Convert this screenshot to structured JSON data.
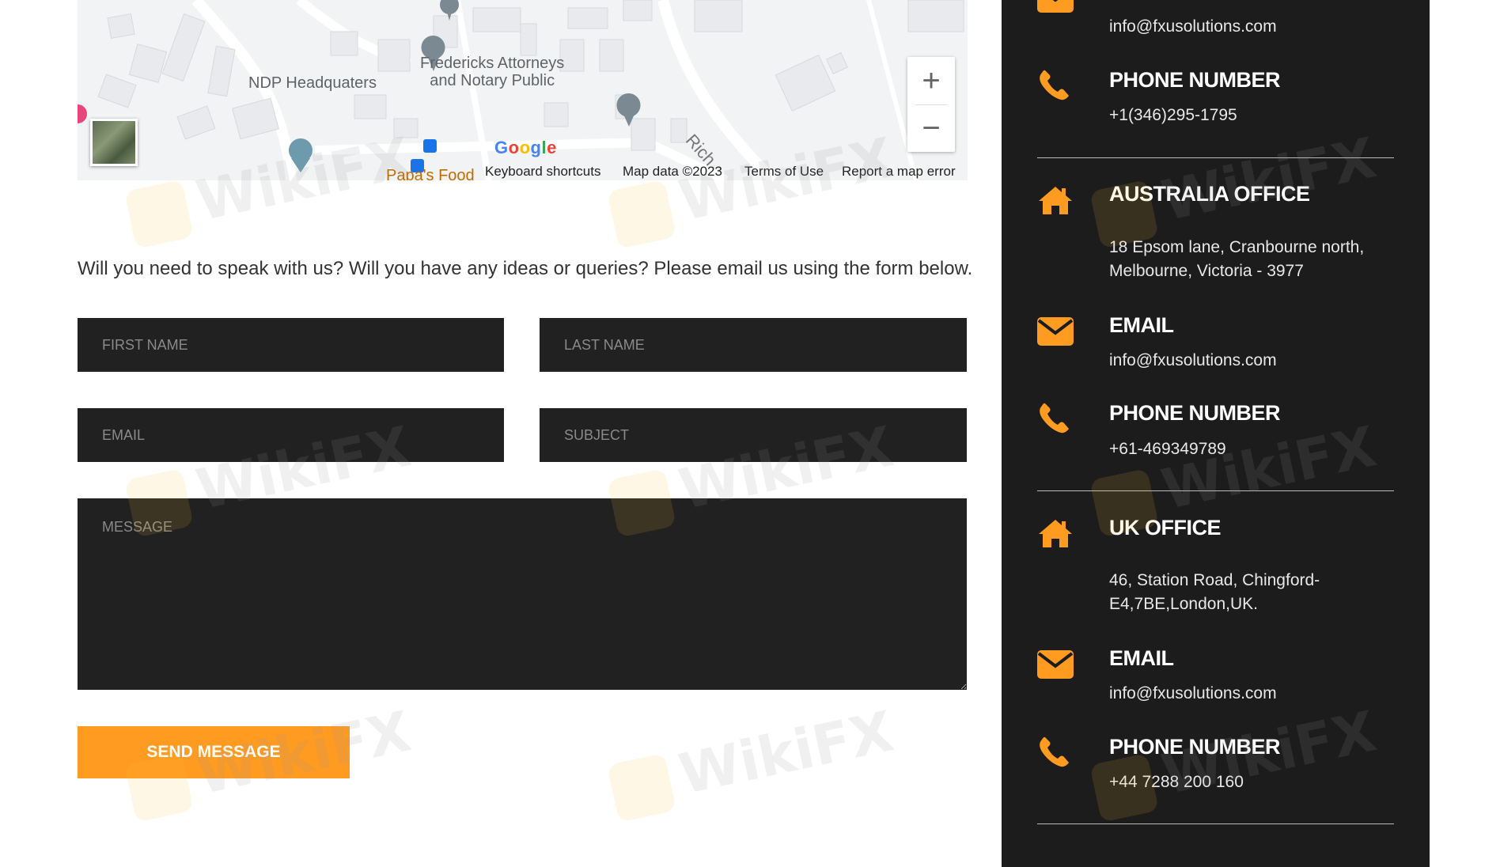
{
  "colors": {
    "accent": "#ff9b21",
    "dark_panel": "#1c1c1c",
    "field_bg": "#212121",
    "text_light": "#ffffff"
  },
  "map": {
    "labels": {
      "ndp": "NDP Headquaters",
      "fredericks": "Fredericks Attorneys\nand Notary Public",
      "papas": "Papa's Food",
      "road": "Rich"
    },
    "google_logo": "Google",
    "footer": {
      "shortcuts": "Keyboard shortcuts",
      "map_data": "Map data ©2023",
      "terms": "Terms of Use",
      "report": "Report a map error"
    },
    "zoom_in": "+",
    "zoom_out": "−"
  },
  "form": {
    "intro": "Will you need to speak with us? Will you have any ideas or queries? Please email us using the form below.",
    "first_name_placeholder": "FIRST NAME",
    "last_name_placeholder": "LAST NAME",
    "email_placeholder": "EMAIL",
    "subject_placeholder": "SUBJECT",
    "message_placeholder": "MESSAGE",
    "send_label": "SEND MESSAGE"
  },
  "sidebar": {
    "us": {
      "email": "info@fxusolutions.com",
      "phone_title": "PHONE NUMBER",
      "phone": "+1(346)295-1795"
    },
    "australia": {
      "title": "AUSTRALIA OFFICE",
      "address_line1": "18 Epsom lane, Cranbourne north,",
      "address_line2": "Melbourne, Victoria - 3977",
      "email_title": "EMAIL",
      "email": "info@fxusolutions.com",
      "phone_title": "PHONE NUMBER",
      "phone": "+61-469349789"
    },
    "uk": {
      "title": "UK OFFICE",
      "address_line1": "46, Station Road, Chingford-",
      "address_line2": "E4,7BE,London,UK.",
      "email_title": "EMAIL",
      "email": "info@fxusolutions.com",
      "phone_title": "PHONE NUMBER",
      "phone": "+44 7288 200 160"
    },
    "icons": [
      "envelope-icon",
      "phone-icon",
      "home-icon"
    ]
  },
  "watermark": "WikiFX"
}
